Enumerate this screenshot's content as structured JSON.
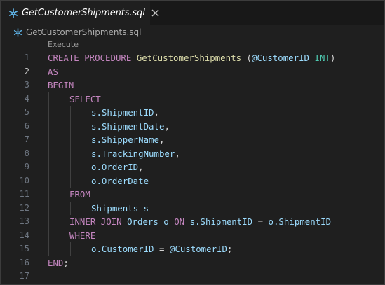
{
  "tab": {
    "title": "GetCustomerShipments.sql",
    "icon": "snowflake-icon",
    "close_icon": "close-icon"
  },
  "breadcrumb": {
    "label": "GetCustomerShipments.sql",
    "icon": "snowflake-icon"
  },
  "codelens": {
    "label": "Execute"
  },
  "editor": {
    "active_line": 2,
    "lines": [
      {
        "n": "1",
        "indent": 0,
        "tokens": [
          [
            "kw",
            "CREATE "
          ],
          [
            "kw",
            "PROCEDURE "
          ],
          [
            "fn",
            "GetCustomerShipments "
          ],
          [
            "op",
            "("
          ],
          [
            "id",
            "@CustomerID "
          ],
          [
            "ty",
            "INT"
          ],
          [
            "op",
            ")"
          ]
        ]
      },
      {
        "n": "2",
        "indent": 0,
        "tokens": [
          [
            "kw",
            "AS"
          ]
        ]
      },
      {
        "n": "3",
        "indent": 0,
        "tokens": [
          [
            "kw",
            "BEGIN"
          ]
        ]
      },
      {
        "n": "4",
        "indent": 1,
        "tokens": [
          [
            "kw",
            "SELECT"
          ]
        ]
      },
      {
        "n": "5",
        "indent": 2,
        "tokens": [
          [
            "id",
            "s.ShipmentID"
          ],
          [
            "op",
            ","
          ]
        ]
      },
      {
        "n": "6",
        "indent": 2,
        "tokens": [
          [
            "id",
            "s.ShipmentDate"
          ],
          [
            "op",
            ","
          ]
        ]
      },
      {
        "n": "7",
        "indent": 2,
        "tokens": [
          [
            "id",
            "s.ShipperName"
          ],
          [
            "op",
            ","
          ]
        ]
      },
      {
        "n": "8",
        "indent": 2,
        "tokens": [
          [
            "id",
            "s.TrackingNumber"
          ],
          [
            "op",
            ","
          ]
        ]
      },
      {
        "n": "9",
        "indent": 2,
        "tokens": [
          [
            "id",
            "o.OrderID"
          ],
          [
            "op",
            ","
          ]
        ]
      },
      {
        "n": "10",
        "indent": 2,
        "tokens": [
          [
            "id",
            "o.OrderDate"
          ]
        ]
      },
      {
        "n": "11",
        "indent": 1,
        "tokens": [
          [
            "kw",
            "FROM"
          ]
        ]
      },
      {
        "n": "12",
        "indent": 2,
        "tokens": [
          [
            "id",
            "Shipments s"
          ]
        ]
      },
      {
        "n": "13",
        "indent": 1,
        "tokens": [
          [
            "kw",
            "INNER "
          ],
          [
            "kw",
            "JOIN "
          ],
          [
            "id",
            "Orders o "
          ],
          [
            "kw",
            "ON "
          ],
          [
            "id",
            "s.ShipmentID "
          ],
          [
            "op",
            "= "
          ],
          [
            "id",
            "o.ShipmentID"
          ]
        ]
      },
      {
        "n": "14",
        "indent": 1,
        "tokens": [
          [
            "kw",
            "WHERE"
          ]
        ]
      },
      {
        "n": "15",
        "indent": 2,
        "tokens": [
          [
            "id",
            "o.CustomerID "
          ],
          [
            "op",
            "= "
          ],
          [
            "id",
            "@CustomerID"
          ],
          [
            "op",
            ";"
          ]
        ]
      },
      {
        "n": "16",
        "indent": 0,
        "tokens": [
          [
            "kw",
            "END"
          ],
          [
            "op",
            ";"
          ]
        ]
      },
      {
        "n": "17",
        "indent": 0,
        "tokens": []
      }
    ]
  },
  "colors": {
    "keyword": "#c586c0",
    "function": "#dcdcaa",
    "identifier": "#9cdcfe",
    "operator": "#d4d4d4",
    "type": "#4ec9b0",
    "icon_accent": "#5fb4e8",
    "tab_border": "#0078d4"
  }
}
